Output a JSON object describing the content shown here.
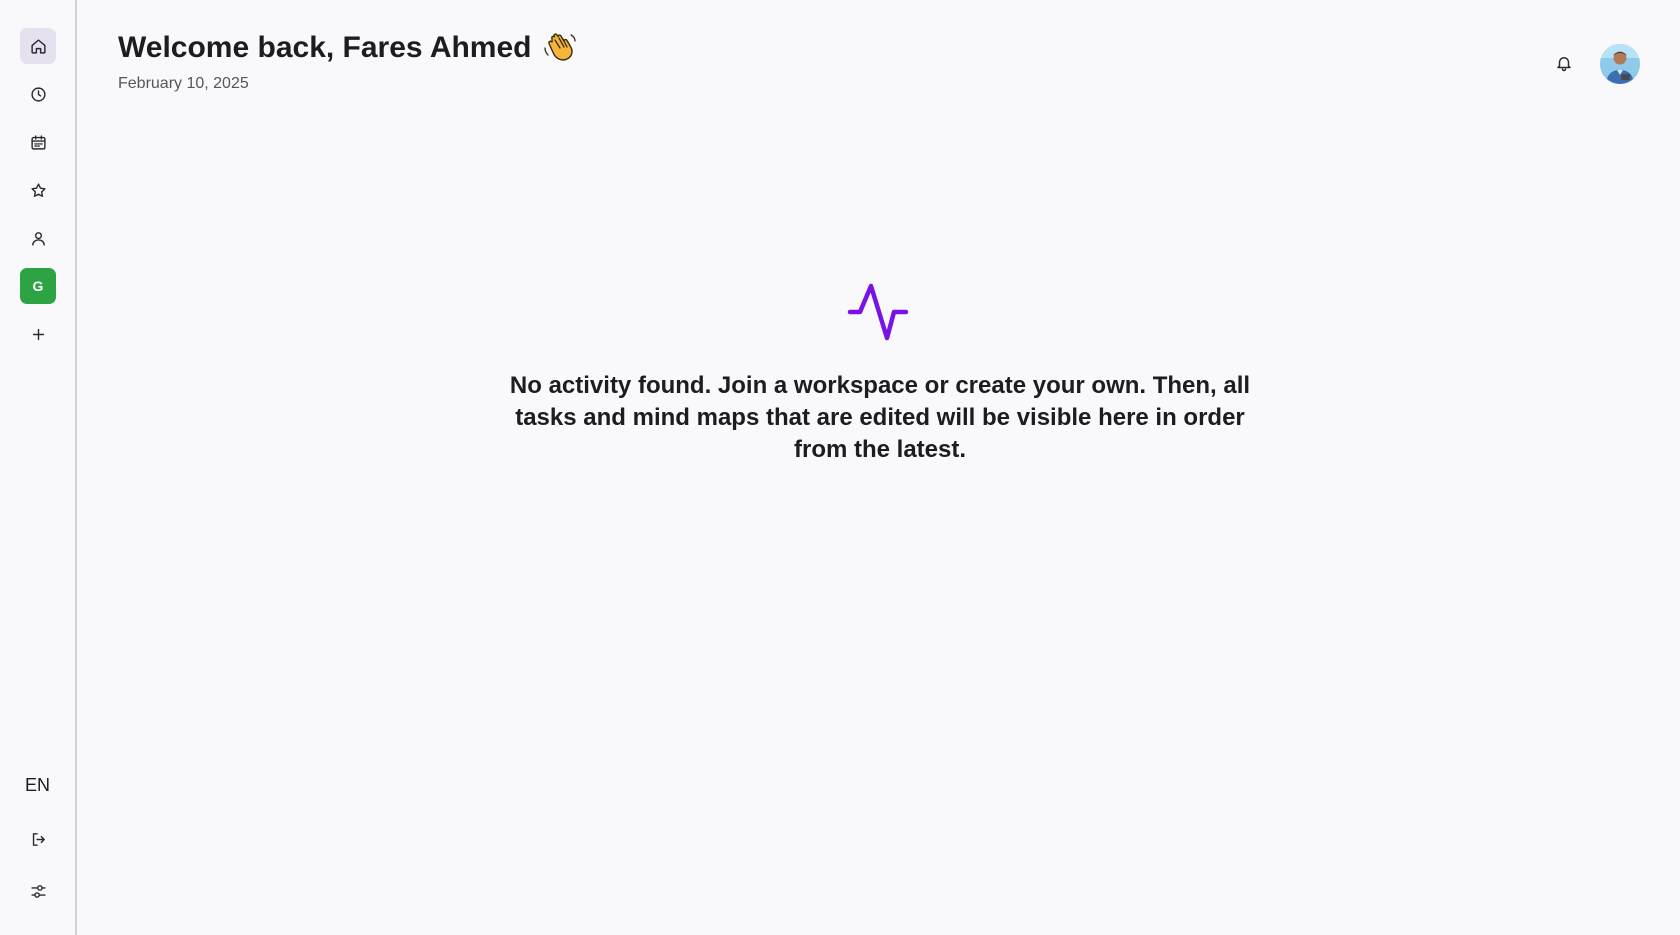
{
  "header": {
    "greeting": "Welcome back, Fares Ahmed",
    "date": "February 10, 2025"
  },
  "sidebar": {
    "items": [
      {
        "name": "home",
        "icon": "home-icon",
        "active": true
      },
      {
        "name": "recent",
        "icon": "clock-icon"
      },
      {
        "name": "calendar",
        "icon": "calendar-icon"
      },
      {
        "name": "favorites",
        "icon": "star-icon"
      },
      {
        "name": "profile",
        "icon": "user-icon"
      },
      {
        "name": "workspace",
        "label": "G",
        "color": "#2ea343"
      },
      {
        "name": "add-workspace",
        "icon": "plus-icon"
      }
    ],
    "language": "EN",
    "bottom": [
      {
        "name": "logout",
        "icon": "logout-icon"
      },
      {
        "name": "settings",
        "icon": "sliders-icon"
      }
    ]
  },
  "empty_state": {
    "icon": "activity-icon",
    "icon_color": "#7a12e6",
    "message": "No activity found. Join a workspace or create your own. Then, all tasks and mind maps that are edited will be visible here in order from the latest."
  },
  "colors": {
    "accent": "#7a12e6",
    "workspace_green": "#2ea343",
    "active_bg": "#e5e1ef"
  }
}
